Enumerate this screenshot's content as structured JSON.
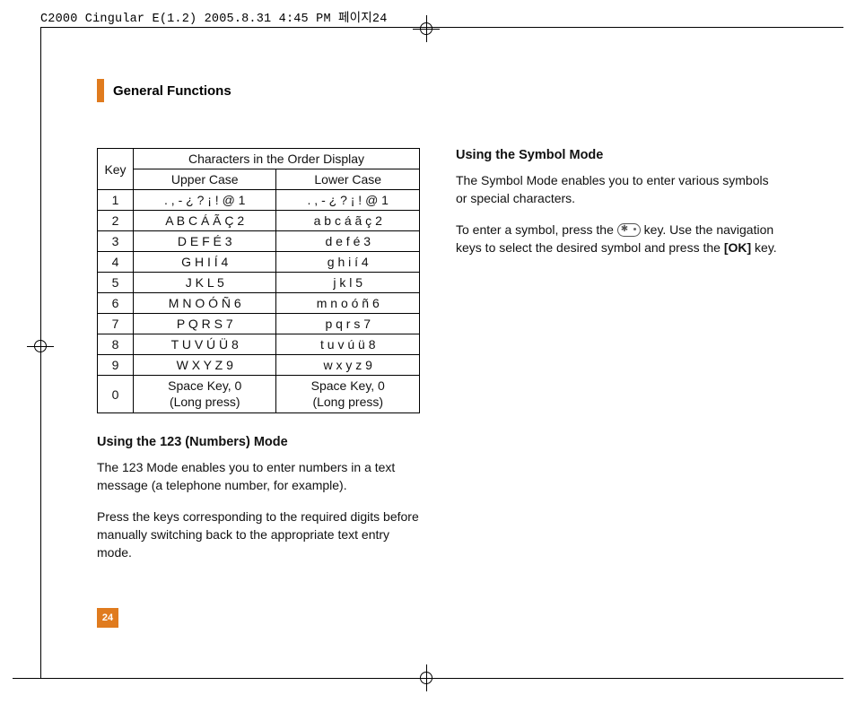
{
  "header_text": "C2000 Cingular  E(1.2)  2005.8.31 4:45 PM  페이지24",
  "section_title": "General Functions",
  "table": {
    "key_header": "Key",
    "span_header": "Characters in the Order Display",
    "upper_header": "Upper Case",
    "lower_header": "Lower Case",
    "rows": [
      {
        "key": "1",
        "upper": ". , - ¿ ? ¡ ! @ 1",
        "lower": ". , - ¿ ? ¡ ! @ 1"
      },
      {
        "key": "2",
        "upper": "A B C Á Ã Ç 2",
        "lower": "a b c á ã ç 2"
      },
      {
        "key": "3",
        "upper": "D E F É 3",
        "lower": "d e f é 3"
      },
      {
        "key": "4",
        "upper": "G H I Í 4",
        "lower": "g h i í 4"
      },
      {
        "key": "5",
        "upper": "J K L 5",
        "lower": "j k l 5"
      },
      {
        "key": "6",
        "upper": "M N O Ó Ñ 6",
        "lower": "m n o ó ñ 6"
      },
      {
        "key": "7",
        "upper": "P Q R S 7",
        "lower": "p q r s 7"
      },
      {
        "key": "8",
        "upper": "T U V Ú Ü 8",
        "lower": "t u v ú ü 8"
      },
      {
        "key": "9",
        "upper": "W X Y Z 9",
        "lower": "w x y z 9"
      },
      {
        "key": "0",
        "upper": "Space Key, 0\n(Long press)",
        "lower": "Space Key, 0\n(Long press)"
      }
    ]
  },
  "left": {
    "subhead": "Using the 123 (Numbers) Mode",
    "p1": "The 123 Mode enables you to enter numbers in a text message (a telephone number, for example).",
    "p2": "Press the keys corresponding to the required digits before manually switching back to the appropriate text entry mode."
  },
  "right": {
    "subhead": "Using the Symbol Mode",
    "p1": "The Symbol Mode enables you to enter various symbols or special characters.",
    "p2a": "To enter a symbol, press the ",
    "p2b": " key. Use the navigation keys to select the desired symbol and press the ",
    "ok": "[OK]",
    "p2c": " key."
  },
  "page_number": "24"
}
